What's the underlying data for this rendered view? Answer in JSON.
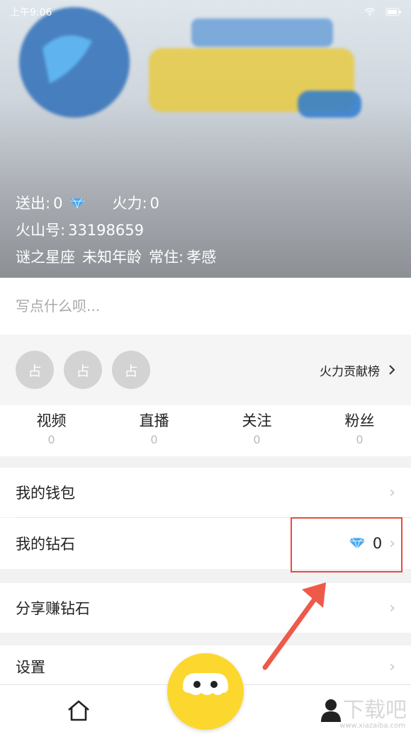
{
  "status_bar": {
    "time": "上午9:06"
  },
  "profile": {
    "sent_label": "送出:",
    "sent_value": "0",
    "firepower_label": "火力:",
    "firepower_value": "0",
    "id_label": "火山号:",
    "id_value": "33198659",
    "zodiac": "谜之星座",
    "age": "未知年龄",
    "residence_label": "常住:",
    "residence_value": "孝感"
  },
  "write": {
    "placeholder": "写点什么呗..."
  },
  "contribution": {
    "seat_label": "占",
    "seats": [
      "占",
      "占",
      "占"
    ],
    "rank_label": "火力贡献榜"
  },
  "counts": [
    {
      "label": "视频",
      "value": "0"
    },
    {
      "label": "直播",
      "value": "0"
    },
    {
      "label": "关注",
      "value": "0"
    },
    {
      "label": "粉丝",
      "value": "0"
    }
  ],
  "menu": {
    "wallet": "我的钱包",
    "diamonds": "我的钻石",
    "diamonds_value": "0",
    "share": "分享赚钻石",
    "settings": "设置"
  },
  "watermark": {
    "brand": "下载吧",
    "url": "www.xiazaiba.com"
  },
  "colors": {
    "accent_red": "#e74c3c",
    "fab_yellow": "#fcd72e",
    "diamond_blue": "#49a8f0"
  },
  "icons": [
    "diamond-icon",
    "chevron-right-icon",
    "home-icon",
    "profile-icon",
    "wifi-icon",
    "battery-icon"
  ]
}
